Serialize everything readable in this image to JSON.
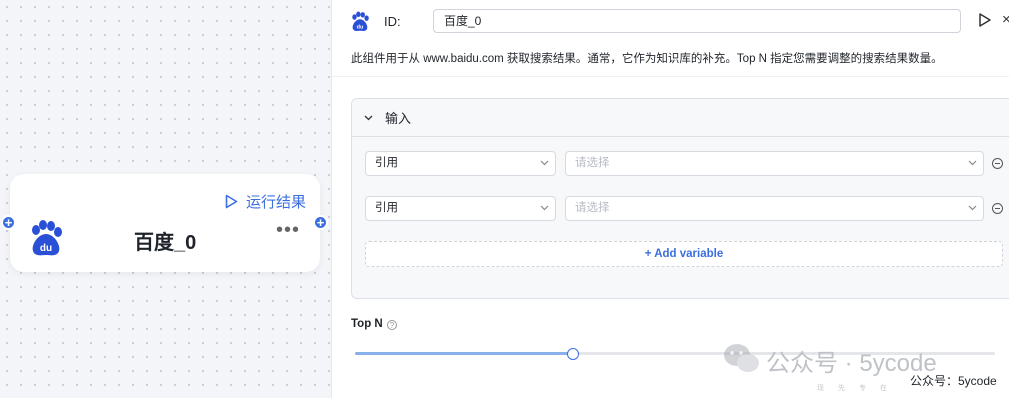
{
  "node": {
    "run_label": "运行结果",
    "title": "百度_0",
    "more": "•••",
    "port_symbol": "+"
  },
  "panel": {
    "id_label": "ID:",
    "id_value": "百度_0",
    "close": "×",
    "description": "此组件用于从 www.baidu.com 获取搜索结果。通常，它作为知识库的补充。Top N 指定您需要调整的搜索结果数量。",
    "input_section": {
      "title": "输入",
      "rows": [
        {
          "type": "引用",
          "placeholder": "请选择"
        },
        {
          "type": "引用",
          "placeholder": "请选择"
        }
      ],
      "add_variable_label": "+ Add variable"
    },
    "top_n": {
      "label": "Top N",
      "help": "?",
      "value_fraction": 0.34
    }
  },
  "watermark": {
    "text1": "公众号 · 5ycode",
    "text2": "公众号：5ycode",
    "text3": "现先专在"
  },
  "colors": {
    "accent": "#3b6fe0",
    "slider_fill": "#8ab0ec"
  },
  "icons": [
    "baidu-paw-icon",
    "play-icon",
    "more-dots-icon",
    "plus-icon",
    "chevron-down-icon",
    "minus-circle-icon",
    "help-icon",
    "close-icon"
  ]
}
